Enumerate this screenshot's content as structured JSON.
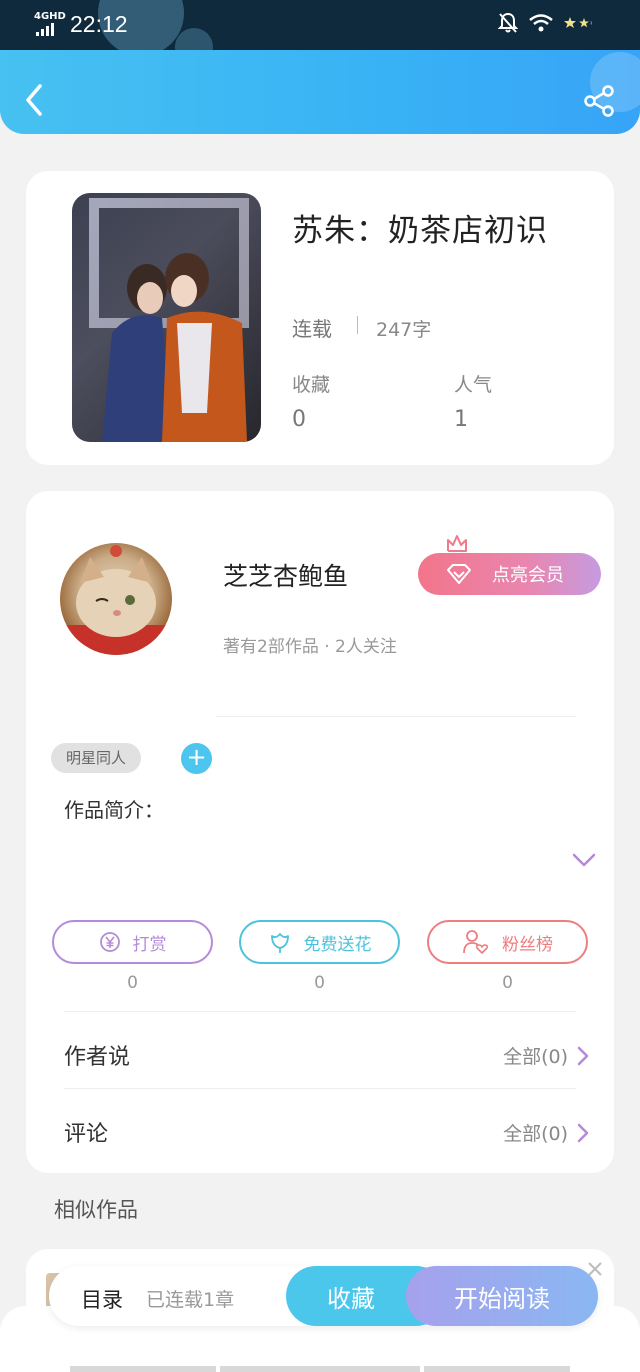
{
  "status_bar": {
    "network": "4GHD",
    "time": "22:12"
  },
  "book": {
    "title": "苏朱：奶茶店初识",
    "status": "连载",
    "word_count": "247字",
    "stats": [
      {
        "label": "收藏",
        "value": "0"
      },
      {
        "label": "人气",
        "value": "1"
      }
    ]
  },
  "author": {
    "name": "芝芝杏鲍鱼",
    "meta": "著有2部作品 · 2人关注",
    "vip_label": "点亮会员"
  },
  "tags": [
    "明星同人"
  ],
  "intro_label": "作品简介：",
  "actions": [
    {
      "label": "打赏",
      "count": "0",
      "color": "#b58ad8"
    },
    {
      "label": "免费送花",
      "count": "0",
      "color": "#4cc3dc"
    },
    {
      "label": "粉丝榜",
      "count": "0",
      "color": "#ee7d80"
    }
  ],
  "rows": [
    {
      "label": "作者说",
      "right": "全部(0)"
    },
    {
      "label": "评论",
      "right": "全部(0)"
    }
  ],
  "similar_title": "相似作品",
  "bottom_bar": {
    "toc": "目录",
    "progress": "已连载1章",
    "favorite": "收藏",
    "start_reading": "开始阅读"
  },
  "colors": {
    "accent": "#3bb4f4",
    "vip": "#f2758a",
    "chevron": "#b58ad8"
  }
}
